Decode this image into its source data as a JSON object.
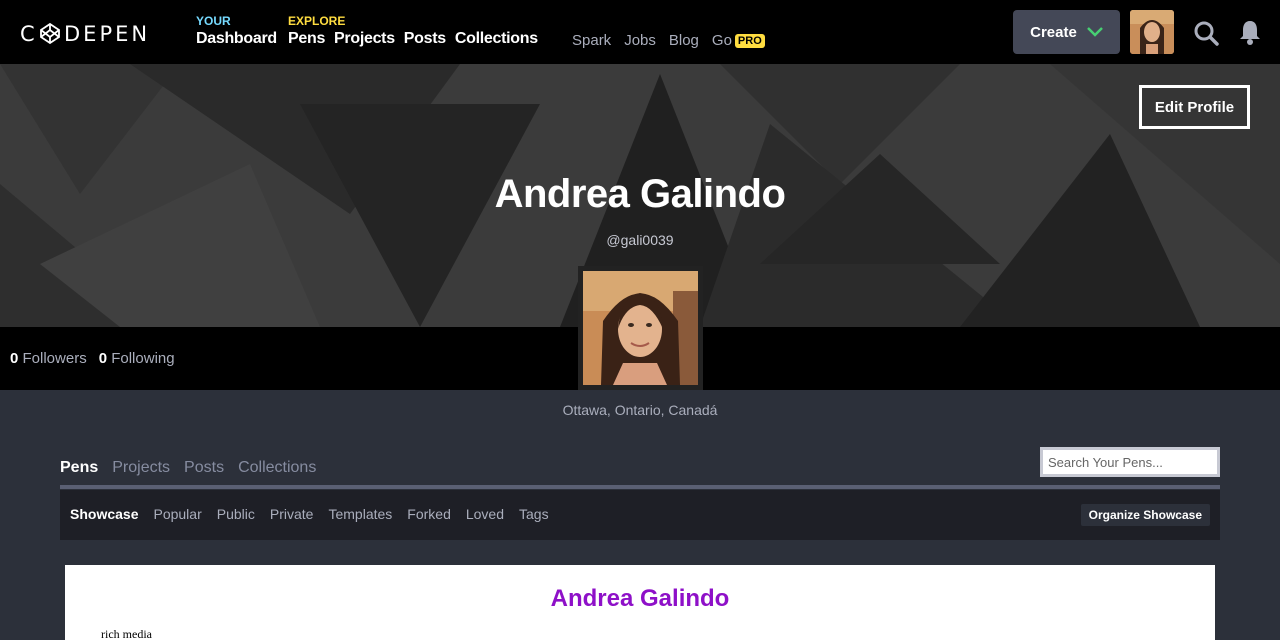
{
  "brand": {
    "logo_text": "CODEPEN"
  },
  "nav": {
    "your_label": "YOUR",
    "dashboard": "Dashboard",
    "explore_label": "EXPLORE",
    "explore_links": [
      "Pens",
      "Projects",
      "Posts",
      "Collections"
    ],
    "minor_links": [
      "Spark",
      "Jobs",
      "Blog",
      "Go"
    ],
    "pro_badge": "PRO",
    "create_label": "Create"
  },
  "profile": {
    "edit_label": "Edit Profile",
    "name": "Andrea Galindo",
    "handle": "@gali0039",
    "followers_count": "0",
    "followers_label": "Followers",
    "following_count": "0",
    "following_label": "Following",
    "location": "Ottawa, Ontario, Canadá"
  },
  "tabs": {
    "items": [
      "Pens",
      "Projects",
      "Posts",
      "Collections"
    ],
    "active": "Pens",
    "search_placeholder": "Search Your Pens..."
  },
  "subtabs": {
    "items": [
      "Showcase",
      "Popular",
      "Public",
      "Private",
      "Templates",
      "Forked",
      "Loved",
      "Tags"
    ],
    "active": "Showcase",
    "organize_label": "Organize Showcase"
  },
  "preview": {
    "title": "Andrea Galindo",
    "text": "rich media"
  },
  "colors": {
    "accent_green": "#47cf73",
    "your_blue": "#76daff",
    "explore_yellow": "#ffdd40",
    "preview_title_purple": "#8e10c8"
  },
  "icons": [
    "codepen-logo-icon",
    "chevron-down-icon",
    "search-icon",
    "bell-icon"
  ]
}
